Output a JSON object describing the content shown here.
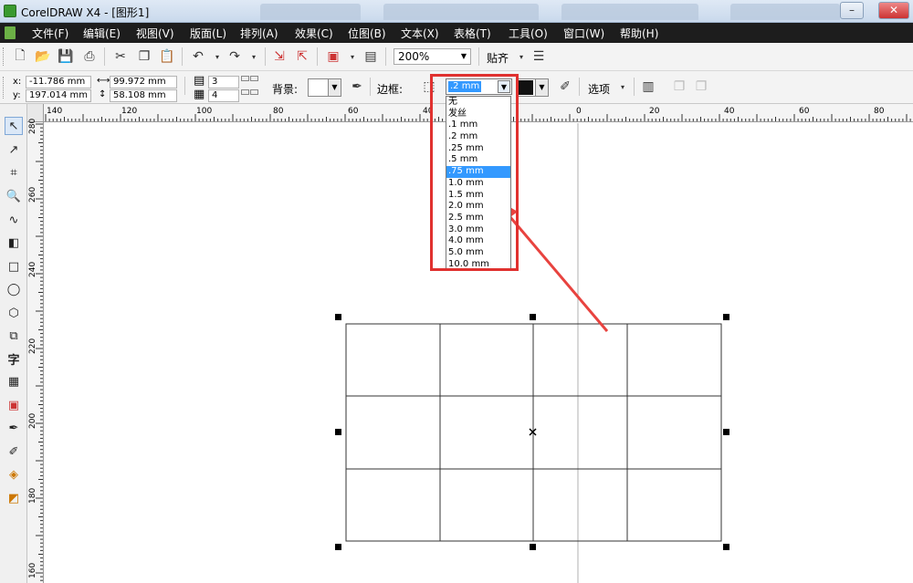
{
  "window": {
    "title": "CorelDRAW X4 - [图形1]",
    "controls": {
      "minimize": "–",
      "maximize": "□",
      "close": "✕"
    }
  },
  "menu": {
    "items": [
      {
        "id": "file",
        "label": "文件(F)"
      },
      {
        "id": "edit",
        "label": "编辑(E)"
      },
      {
        "id": "view",
        "label": "视图(V)"
      },
      {
        "id": "layout",
        "label": "版面(L)"
      },
      {
        "id": "arrange",
        "label": "排列(A)"
      },
      {
        "id": "effects",
        "label": "效果(C)"
      },
      {
        "id": "bitmaps",
        "label": "位图(B)"
      },
      {
        "id": "text",
        "label": "文本(X)"
      },
      {
        "id": "table",
        "label": "表格(T)"
      },
      {
        "id": "tools",
        "label": "工具(O)"
      },
      {
        "id": "window",
        "label": "窗口(W)"
      },
      {
        "id": "help",
        "label": "帮助(H)"
      }
    ]
  },
  "standard_toolbar": {
    "zoom": "200%",
    "snap_label": "贴齐"
  },
  "property_bar": {
    "x_label": "x:",
    "x_value": "-11.786 mm",
    "y_label": "y:",
    "y_value": "197.014 mm",
    "width_value": "99.972 mm",
    "height_value": "58.108 mm",
    "rows": "3",
    "cols": "4",
    "background_label": "背景:",
    "border_label": "边框:",
    "outline_width": ".2 mm",
    "options_label": "选项"
  },
  "outline_dropdown": {
    "options": [
      "无",
      "发丝",
      ".1 mm",
      ".2 mm",
      ".25 mm",
      ".5 mm",
      ".75 mm",
      "1.0 mm",
      "1.5 mm",
      "2.0 mm",
      "2.5 mm",
      "3.0 mm",
      "4.0 mm",
      "5.0 mm",
      "10.0 mm"
    ],
    "selected": ".75 mm"
  },
  "rulers": {
    "horizontal_labels": [
      "140",
      "120",
      "100",
      "80",
      "60",
      "40",
      "0",
      "20",
      "40",
      "60",
      "80"
    ],
    "vertical_labels": [
      "280",
      "260",
      "240",
      "220",
      "200",
      "180",
      "160"
    ]
  },
  "table_object": {
    "rows": 3,
    "cols": 4
  },
  "toolbox": {
    "tools": [
      "pick-tool",
      "shape-tool",
      "crop-tool",
      "zoom-tool",
      "freehand-tool",
      "smart-fill-tool",
      "rectangle-tool",
      "ellipse-tool",
      "polygon-tool",
      "basic-shapes-tool",
      "text-tool",
      "table-tool",
      "interactive-blend-tool",
      "eyedropper-tool",
      "outline-tool",
      "fill-tool",
      "interactive-fill-tool"
    ]
  },
  "colors": {
    "menubar_bg": "#1d1d1d",
    "highlight": "#3399ff",
    "annotation_red": "#e0312f"
  }
}
